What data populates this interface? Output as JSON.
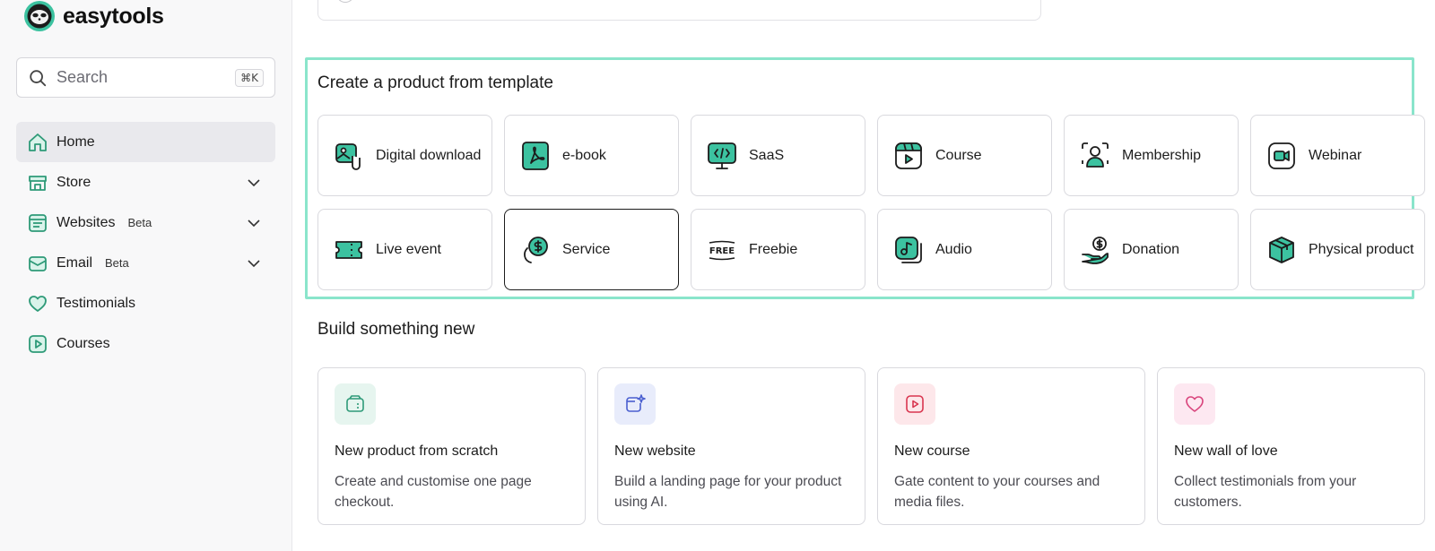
{
  "brand": {
    "name": "easytools"
  },
  "search": {
    "placeholder": "Search",
    "shortcut": "⌘K"
  },
  "nav": {
    "items": [
      {
        "label": "Home",
        "icon": "home-icon",
        "active": true
      },
      {
        "label": "Store",
        "icon": "store-icon",
        "expandable": true
      },
      {
        "label": "Websites",
        "badge": "Beta",
        "icon": "websites-icon",
        "expandable": true
      },
      {
        "label": "Email",
        "badge": "Beta",
        "icon": "email-icon",
        "expandable": true
      },
      {
        "label": "Testimonials",
        "icon": "heart-icon"
      },
      {
        "label": "Courses",
        "icon": "play-icon"
      }
    ]
  },
  "templates": {
    "title": "Create a product from template",
    "items": [
      {
        "label": "Digital download",
        "icon": "digital-download-icon"
      },
      {
        "label": "e-book",
        "icon": "pdf-icon"
      },
      {
        "label": "SaaS",
        "icon": "code-monitor-icon"
      },
      {
        "label": "Course",
        "icon": "course-icon"
      },
      {
        "label": "Membership",
        "icon": "membership-icon"
      },
      {
        "label": "Webinar",
        "icon": "webinar-icon"
      },
      {
        "label": "Live event",
        "icon": "ticket-icon"
      },
      {
        "label": "Service",
        "icon": "service-icon",
        "selected": true
      },
      {
        "label": "Freebie",
        "icon": "free-icon",
        "icon_text": "FREE"
      },
      {
        "label": "Audio",
        "icon": "audio-icon"
      },
      {
        "label": "Donation",
        "icon": "donation-icon"
      },
      {
        "label": "Physical product",
        "icon": "box-icon"
      }
    ]
  },
  "build": {
    "title": "Build something new",
    "items": [
      {
        "title": "New product from scratch",
        "desc": "Create and customise one page checkout.",
        "icon": "wallet-icon",
        "tint": "#e6f5ef",
        "color": "#2e9a78"
      },
      {
        "title": "New website",
        "desc": "Build a landing page for your product using AI.",
        "icon": "sparkle-window-icon",
        "tint": "#e8ecfb",
        "color": "#4a5fd0"
      },
      {
        "title": "New course",
        "desc": "Gate content to your courses and media files.",
        "icon": "video-icon",
        "tint": "#fde7ea",
        "color": "#d9354f"
      },
      {
        "title": "New wall of love",
        "desc": "Collect testimonials from your customers.",
        "icon": "heart-icon",
        "tint": "#fde8f1",
        "color": "#d9457d"
      }
    ]
  },
  "colors": {
    "accent": "#3cc2a0",
    "highlight": "#8ae5cb",
    "sidebar_bg": "#f8f8f9"
  }
}
